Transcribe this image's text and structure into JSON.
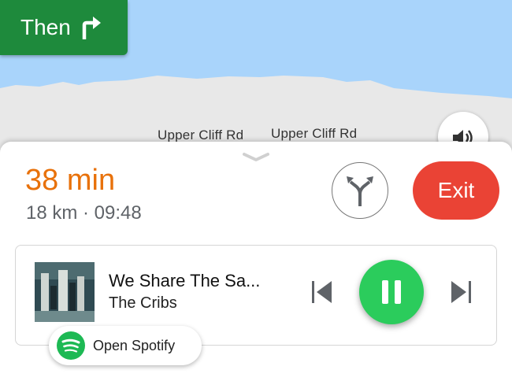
{
  "next_turn": {
    "label": "Then",
    "icon": "turn-right-icon"
  },
  "map": {
    "streets": [
      "Upper Cliff Rd",
      "Upper Cliff Rd"
    ],
    "colors": {
      "water": "#a9d4fb",
      "land": "#e8e8e8"
    }
  },
  "sound_button": {
    "icon": "volume-icon"
  },
  "trip": {
    "eta_value": "38",
    "eta_unit": "min",
    "details": "18 km · 09:48"
  },
  "routes_button": {
    "icon": "alternate-routes-icon"
  },
  "exit_button": {
    "label": "Exit"
  },
  "media": {
    "title": "We Share The Sa...",
    "artist": "The Cribs",
    "controls": [
      "previous-track-icon",
      "pause-icon",
      "next-track-icon"
    ],
    "open_app_label": "Open Spotify",
    "app_icon": "spotify-icon"
  },
  "colors": {
    "turn_chip": "#1e8a3c",
    "eta": "#e8710a",
    "exit": "#ea4335",
    "play": "#2bcc5c",
    "spotify": "#1db954"
  }
}
